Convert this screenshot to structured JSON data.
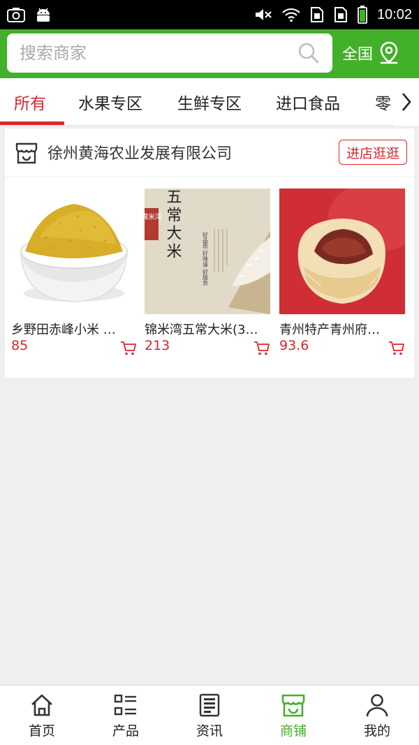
{
  "statusbar": {
    "time": "10:02"
  },
  "header": {
    "search_placeholder": "搜索商家",
    "region_label": "全国"
  },
  "tabs": [
    {
      "label": "所有",
      "active": true
    },
    {
      "label": "水果专区"
    },
    {
      "label": "生鲜专区"
    },
    {
      "label": "进口食品"
    },
    {
      "label": "零"
    }
  ],
  "shop": {
    "name": "徐州黄海农业发展有限公司",
    "visit_label": "进店逛逛",
    "products": [
      {
        "name": "乡野田赤峰小米 …",
        "price": "85"
      },
      {
        "name": "锦米湾五常大米(3…",
        "price": "213",
        "image_text": {
          "title": "五常大米",
          "seal": "锦米湾",
          "slogan": "好品质·好味道·好服务"
        }
      },
      {
        "name": "青州特产青州府…",
        "price": "93.6"
      }
    ]
  },
  "bottom_nav": [
    {
      "label": "首页",
      "icon": "home-icon"
    },
    {
      "label": "产品",
      "icon": "list-icon"
    },
    {
      "label": "资讯",
      "icon": "news-icon"
    },
    {
      "label": "商铺",
      "icon": "shop-icon",
      "active": true
    },
    {
      "label": "我的",
      "icon": "user-icon"
    }
  ],
  "colors": {
    "brand_green": "#43b02a",
    "accent_red": "#d8262c"
  }
}
